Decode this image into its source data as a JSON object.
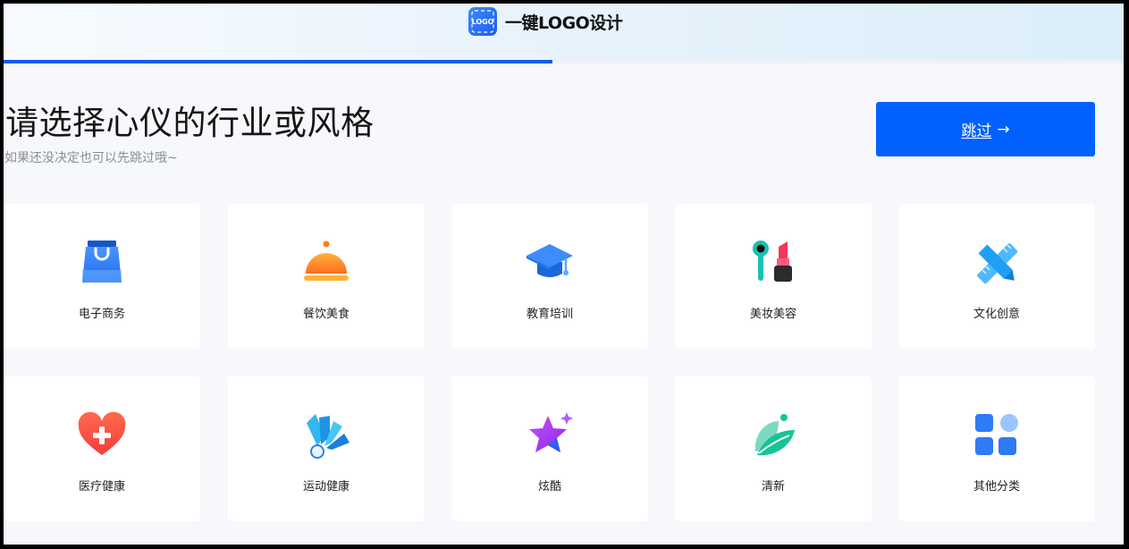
{
  "header": {
    "brand_name": "一键LOGO设计",
    "brand_logo_text": "LOGO",
    "progress_fraction": 0.49
  },
  "main": {
    "title": "请选择心仪的行业或风格",
    "subtitle": "如果还没决定也可以先跳过哦~",
    "skip_label": "跳过",
    "skip_arrow": "→"
  },
  "categories": [
    {
      "label": "电子商务",
      "icon": "shopping-bag-icon"
    },
    {
      "label": "餐饮美食",
      "icon": "food-cloche-icon"
    },
    {
      "label": "教育培训",
      "icon": "graduation-cap-icon"
    },
    {
      "label": "美妆美容",
      "icon": "cosmetics-icon"
    },
    {
      "label": "文化创意",
      "icon": "pencil-ruler-icon"
    },
    {
      "label": "医疗健康",
      "icon": "medical-heart-icon"
    },
    {
      "label": "运动健康",
      "icon": "shuttlecock-icon"
    },
    {
      "label": "炫酷",
      "icon": "sparkle-star-icon"
    },
    {
      "label": "清新",
      "icon": "leaf-icon"
    },
    {
      "label": "其他分类",
      "icon": "grid-apps-icon"
    }
  ],
  "colors": {
    "accent": "#0061ff",
    "progress": "#0c5ef0",
    "background": "#f6f8fb"
  }
}
